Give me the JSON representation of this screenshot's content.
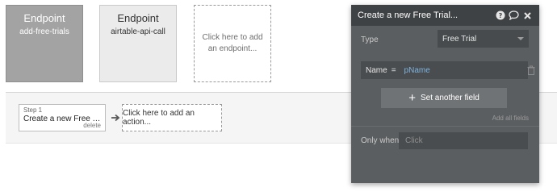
{
  "endpoints": [
    {
      "title": "Endpoint",
      "subtitle": "add-free-trials",
      "active": true
    },
    {
      "title": "Endpoint",
      "subtitle": "airtable-api-call",
      "active": false
    }
  ],
  "add_endpoint_label": "Click here to add an endpoint...",
  "workflow": {
    "step_label": "Step 1",
    "step_title": "Create a new Free Trial...",
    "step_delete": "delete",
    "add_action_label": "Click here to add an action..."
  },
  "panel": {
    "title": "Create a new Free Trial...",
    "icons": [
      "help-icon",
      "comment-icon",
      "close-icon"
    ],
    "type_label": "Type",
    "type_value": "Free Trial",
    "field_key": "Name",
    "field_operator": "=",
    "field_value": "pName",
    "set_another_field_label": "Set another field",
    "add_all_fields_label": "Add all fields",
    "only_when_label": "Only when",
    "only_when_placeholder": "Click"
  },
  "colors": {
    "panel_bg": "#5b5e60",
    "panel_header": "#3f4244",
    "dynamic_value": "#7fb2dd",
    "endpoint_active": "#a3a3a3"
  }
}
